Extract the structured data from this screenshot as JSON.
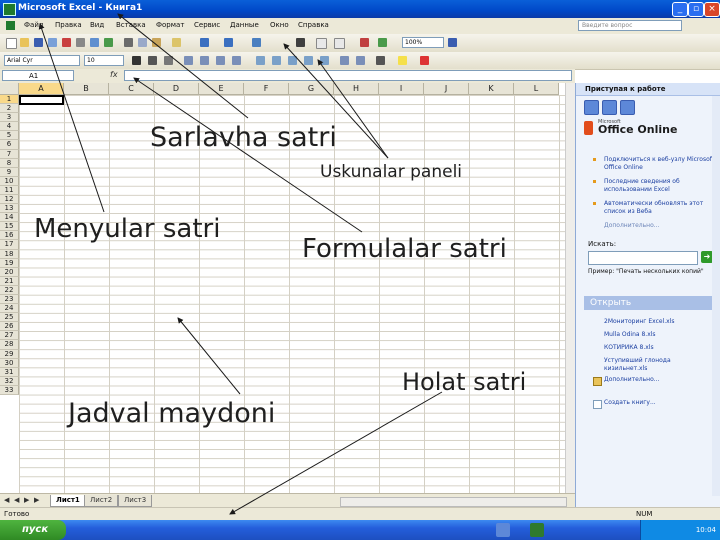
{
  "window": {
    "title": "Microsoft Excel - Книга1",
    "minimize": "_",
    "restore": "▫",
    "close": "×"
  },
  "menu": {
    "items": [
      "Файл",
      "Правка",
      "Вид",
      "Вставка",
      "Формат",
      "Сервис",
      "Данные",
      "Окно",
      "Справка"
    ],
    "ask_placeholder": "Введите вопрос"
  },
  "toolbar": {
    "zoom": "100%"
  },
  "format_bar": {
    "font": "Arial Cyr",
    "size": "10"
  },
  "formula_bar": {
    "name_box": "A1",
    "fx": "fx"
  },
  "grid": {
    "columns": [
      "A",
      "B",
      "C",
      "D",
      "E",
      "F",
      "G",
      "H",
      "I",
      "J",
      "K",
      "L"
    ],
    "rows": [
      "1",
      "2",
      "3",
      "4",
      "5",
      "6",
      "7",
      "8",
      "9",
      "10",
      "11",
      "12",
      "13",
      "14",
      "15",
      "16",
      "17",
      "18",
      "19",
      "20",
      "21",
      "22",
      "23",
      "24",
      "25",
      "26",
      "27",
      "28",
      "29",
      "30",
      "31",
      "32",
      "33"
    ]
  },
  "sheets": {
    "tabs": [
      "Лист1",
      "Лист2",
      "Лист3"
    ]
  },
  "status": {
    "text": "Готово",
    "num": "NUM"
  },
  "taskbar": {
    "start": "пуск",
    "clock": "10:04"
  },
  "task_pane": {
    "title": "Приступая к работе",
    "brand_small": "Microsoft",
    "brand": "Office Online",
    "links": [
      "Подключиться к веб-узлу Microsoft Office Online",
      "Последние сведения об использовании Excel",
      "Автоматически обновлять этот список из Веба"
    ],
    "more": "Дополнительно...",
    "search_label": "Искать:",
    "example": "Пример: \"Печать нескольких копий\"",
    "open_header": "Открыть",
    "files": [
      "2Мониторинг Excel.xls",
      "Mulla Odina 8.xls",
      "КОТИРИКА 8.xls",
      "Уступивший глонода кизильнет.xls"
    ],
    "more_files": "Дополнительно...",
    "create": "Создать книгу..."
  },
  "annotations": {
    "title_bar": "Sarlavha satri",
    "toolbars": "Uskunalar paneli",
    "menu_bar": "Menyular satri",
    "formula_bar": "Formulalar satri",
    "status_bar": "Holat satri",
    "sheet_area": "Jadval maydoni"
  },
  "colors": {
    "title_blue": "#0a5fd8",
    "active_header": "#f9d98a",
    "start_green": "#2f8a24"
  }
}
